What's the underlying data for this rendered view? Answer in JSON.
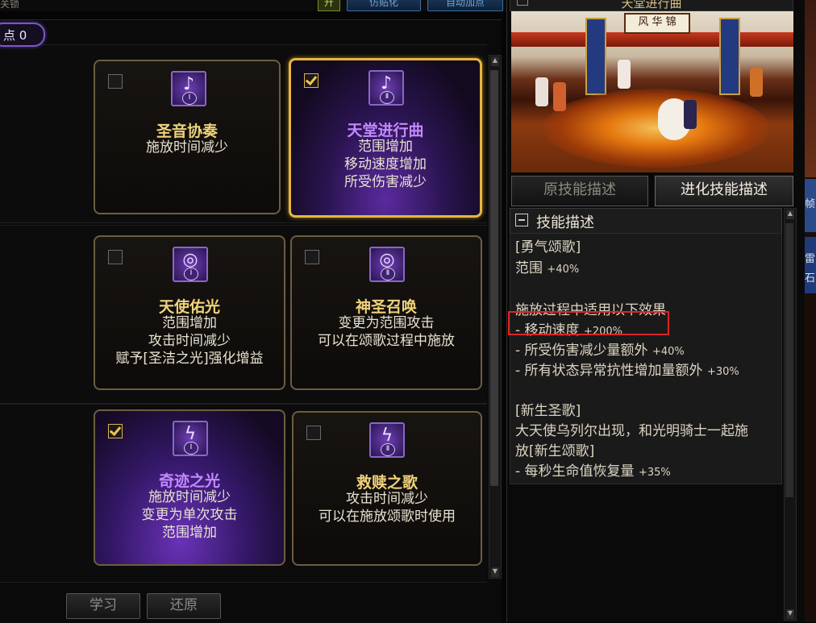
{
  "top": {
    "left_text": "关锁",
    "yellow_label": "升",
    "btn1_label": "仿贴化",
    "btn2_label": "自动加点"
  },
  "points": {
    "label": "点 0"
  },
  "skills": [
    {
      "title": "圣音协奏",
      "checked": false,
      "rank": "Ⅰ",
      "lines": [
        "施放时间减少"
      ]
    },
    {
      "title": "天堂进行曲",
      "checked": true,
      "rank": "Ⅱ",
      "lines": [
        "范围增加",
        "移动速度增加",
        "所受伤害减少"
      ]
    },
    {
      "title": "天使佑光",
      "checked": false,
      "rank": "Ⅰ",
      "lines": [
        "范围增加",
        "攻击时间减少",
        "赋予[圣洁之光]强化增益"
      ]
    },
    {
      "title": "神圣召唤",
      "checked": false,
      "rank": "Ⅱ",
      "lines": [
        "变更为范围攻击",
        "可以在颂歌过程中施放"
      ]
    },
    {
      "title": "奇迹之光",
      "checked": true,
      "rank": "Ⅰ",
      "lines": [
        "施放时间减少",
        "变更为单次攻击",
        "范围增加"
      ]
    },
    {
      "title": "救赎之歌",
      "checked": false,
      "rank": "Ⅱ",
      "lines": [
        "攻击时间减少",
        "可以在施放颂歌时使用"
      ]
    }
  ],
  "buttons": {
    "learn": "学习",
    "reset": "还原"
  },
  "right": {
    "header_title": "天堂进行曲",
    "scene_sign": "风 华 锦",
    "tab_original": "原技能描述",
    "tab_evolved": "进化技能描述",
    "desc_title": "技能描述",
    "desc": {
      "l1": "[勇气颂歌]",
      "l2a": "范围 ",
      "l2b": "+40%",
      "l3": "施放过程中适用以下效果",
      "l4a": "- 移动速度 ",
      "l4b": "+200%",
      "l5a": "- 所受伤害减少量额外 ",
      "l5b": "+40%",
      "l6a": "- 所有状态异常抗性增加量额外 ",
      "l6b": "+30%",
      "l7": "[新生圣歌]",
      "l8": "大天使乌列尔出现，和光明骑士一起施",
      "l9": "放[新生颂歌]",
      "l10a": "- 每秒生命值恢复量 ",
      "l10b": "+35%"
    },
    "edge_t1": "帧",
    "edge_t2": "雷",
    "edge_t3": "石"
  },
  "colors": {
    "highlight": "#e02424",
    "gold": "#e6b640",
    "purple": "#7d55c8"
  }
}
